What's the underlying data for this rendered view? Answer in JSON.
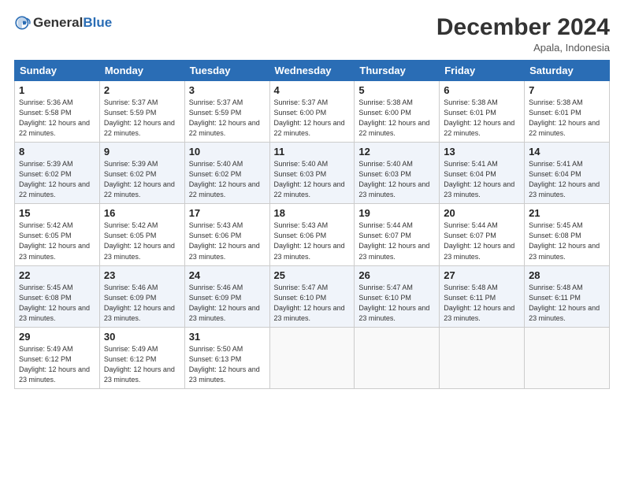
{
  "logo": {
    "general": "General",
    "blue": "Blue"
  },
  "header": {
    "month": "December 2024",
    "location": "Apala, Indonesia"
  },
  "days_of_week": [
    "Sunday",
    "Monday",
    "Tuesday",
    "Wednesday",
    "Thursday",
    "Friday",
    "Saturday"
  ],
  "weeks": [
    [
      {
        "day": "1",
        "rise": "5:36 AM",
        "set": "5:58 PM",
        "daylight": "12 hours and 22 minutes."
      },
      {
        "day": "2",
        "rise": "5:37 AM",
        "set": "5:59 PM",
        "daylight": "12 hours and 22 minutes."
      },
      {
        "day": "3",
        "rise": "5:37 AM",
        "set": "5:59 PM",
        "daylight": "12 hours and 22 minutes."
      },
      {
        "day": "4",
        "rise": "5:37 AM",
        "set": "6:00 PM",
        "daylight": "12 hours and 22 minutes."
      },
      {
        "day": "5",
        "rise": "5:38 AM",
        "set": "6:00 PM",
        "daylight": "12 hours and 22 minutes."
      },
      {
        "day": "6",
        "rise": "5:38 AM",
        "set": "6:01 PM",
        "daylight": "12 hours and 22 minutes."
      },
      {
        "day": "7",
        "rise": "5:38 AM",
        "set": "6:01 PM",
        "daylight": "12 hours and 22 minutes."
      }
    ],
    [
      {
        "day": "8",
        "rise": "5:39 AM",
        "set": "6:02 PM",
        "daylight": "12 hours and 22 minutes."
      },
      {
        "day": "9",
        "rise": "5:39 AM",
        "set": "6:02 PM",
        "daylight": "12 hours and 22 minutes."
      },
      {
        "day": "10",
        "rise": "5:40 AM",
        "set": "6:02 PM",
        "daylight": "12 hours and 22 minutes."
      },
      {
        "day": "11",
        "rise": "5:40 AM",
        "set": "6:03 PM",
        "daylight": "12 hours and 22 minutes."
      },
      {
        "day": "12",
        "rise": "5:40 AM",
        "set": "6:03 PM",
        "daylight": "12 hours and 23 minutes."
      },
      {
        "day": "13",
        "rise": "5:41 AM",
        "set": "6:04 PM",
        "daylight": "12 hours and 23 minutes."
      },
      {
        "day": "14",
        "rise": "5:41 AM",
        "set": "6:04 PM",
        "daylight": "12 hours and 23 minutes."
      }
    ],
    [
      {
        "day": "15",
        "rise": "5:42 AM",
        "set": "6:05 PM",
        "daylight": "12 hours and 23 minutes."
      },
      {
        "day": "16",
        "rise": "5:42 AM",
        "set": "6:05 PM",
        "daylight": "12 hours and 23 minutes."
      },
      {
        "day": "17",
        "rise": "5:43 AM",
        "set": "6:06 PM",
        "daylight": "12 hours and 23 minutes."
      },
      {
        "day": "18",
        "rise": "5:43 AM",
        "set": "6:06 PM",
        "daylight": "12 hours and 23 minutes."
      },
      {
        "day": "19",
        "rise": "5:44 AM",
        "set": "6:07 PM",
        "daylight": "12 hours and 23 minutes."
      },
      {
        "day": "20",
        "rise": "5:44 AM",
        "set": "6:07 PM",
        "daylight": "12 hours and 23 minutes."
      },
      {
        "day": "21",
        "rise": "5:45 AM",
        "set": "6:08 PM",
        "daylight": "12 hours and 23 minutes."
      }
    ],
    [
      {
        "day": "22",
        "rise": "5:45 AM",
        "set": "6:08 PM",
        "daylight": "12 hours and 23 minutes."
      },
      {
        "day": "23",
        "rise": "5:46 AM",
        "set": "6:09 PM",
        "daylight": "12 hours and 23 minutes."
      },
      {
        "day": "24",
        "rise": "5:46 AM",
        "set": "6:09 PM",
        "daylight": "12 hours and 23 minutes."
      },
      {
        "day": "25",
        "rise": "5:47 AM",
        "set": "6:10 PM",
        "daylight": "12 hours and 23 minutes."
      },
      {
        "day": "26",
        "rise": "5:47 AM",
        "set": "6:10 PM",
        "daylight": "12 hours and 23 minutes."
      },
      {
        "day": "27",
        "rise": "5:48 AM",
        "set": "6:11 PM",
        "daylight": "12 hours and 23 minutes."
      },
      {
        "day": "28",
        "rise": "5:48 AM",
        "set": "6:11 PM",
        "daylight": "12 hours and 23 minutes."
      }
    ],
    [
      {
        "day": "29",
        "rise": "5:49 AM",
        "set": "6:12 PM",
        "daylight": "12 hours and 23 minutes."
      },
      {
        "day": "30",
        "rise": "5:49 AM",
        "set": "6:12 PM",
        "daylight": "12 hours and 23 minutes."
      },
      {
        "day": "31",
        "rise": "5:50 AM",
        "set": "6:13 PM",
        "daylight": "12 hours and 23 minutes."
      },
      null,
      null,
      null,
      null
    ]
  ]
}
